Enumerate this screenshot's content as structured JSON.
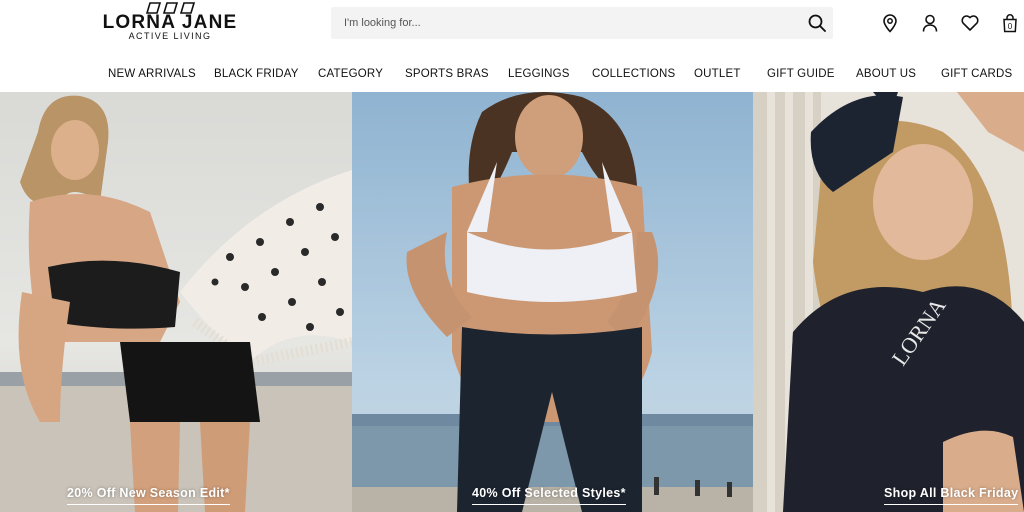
{
  "brand": {
    "name": "LORNA JANE",
    "tagline": "ACTIVE LIVING"
  },
  "search": {
    "placeholder": "I'm looking for...",
    "value": ""
  },
  "header_icons": [
    "location-pin-icon",
    "account-icon",
    "heart-icon",
    "bag-icon"
  ],
  "cart": {
    "count": "0"
  },
  "nav": {
    "items": [
      "NEW ARRIVALS",
      "BLACK FRIDAY",
      "CATEGORY",
      "SPORTS BRAS",
      "LEGGINGS",
      "COLLECTIONS",
      "OUTLET",
      "GIFT GUIDE",
      "ABOUT US",
      "GIFT CARDS"
    ]
  },
  "hero": {
    "panels": [
      {
        "caption": "20% Off New Season Edit*"
      },
      {
        "caption": "40% Off Selected Styles*"
      },
      {
        "caption": "Shop All Black Friday"
      }
    ]
  },
  "colors": {
    "text": "#111111",
    "search_bg": "#f3f3f3",
    "caption": "#ffffff"
  }
}
